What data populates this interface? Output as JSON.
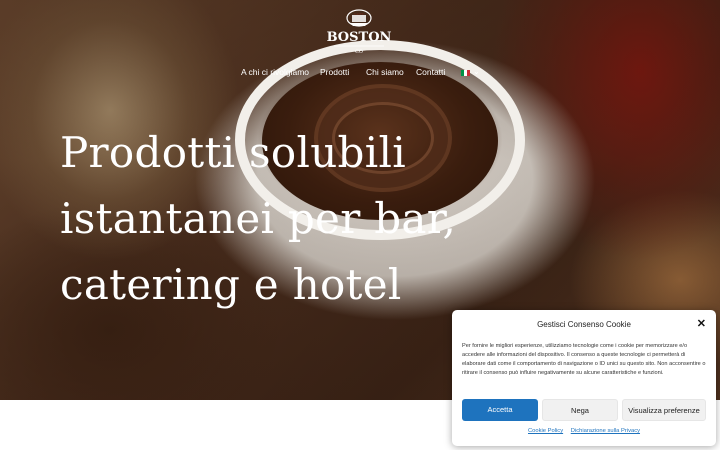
{
  "logo": {
    "small_text": "CAFFE",
    "brand": "BOSTON",
    "sub": "CO"
  },
  "nav": {
    "items": [
      {
        "label": "A chi ci rivolgiamo"
      },
      {
        "label": "Prodotti"
      },
      {
        "label": "Chi siamo"
      },
      {
        "label": "Contatti"
      }
    ],
    "language_icon": "italy-flag-icon",
    "dropdown_icon": "chevron-down-icon"
  },
  "hero": {
    "headline_lines": [
      "Prodotti solubili",
      "istantanei per bar,",
      "catering e hotel"
    ]
  },
  "cookie_banner": {
    "title": "Gestisci Consenso Cookie",
    "text": "Per fornire le migliori esperienze, utilizziamo tecnologie come i cookie per memorizzare e/o accedere alle informazioni del dispositivo. Il consenso a queste tecnologie ci permetterà di elaborare dati come il comportamento di navigazione o ID unici su questo sito. Non acconsentire o ritirare il consenso può influire negativamente su alcune caratteristiche e funzioni.",
    "accept_label": "Accetta",
    "deny_label": "Nega",
    "preferences_label": "Visualizza preferenze",
    "links": [
      "Cookie Policy",
      "Dichiarazione sulla Privacy"
    ],
    "close_icon": "close-icon",
    "accent_color": "#1e73be"
  },
  "colors": {
    "flag_green": "#009246",
    "flag_white": "#ffffff",
    "flag_red": "#ce2b37"
  }
}
